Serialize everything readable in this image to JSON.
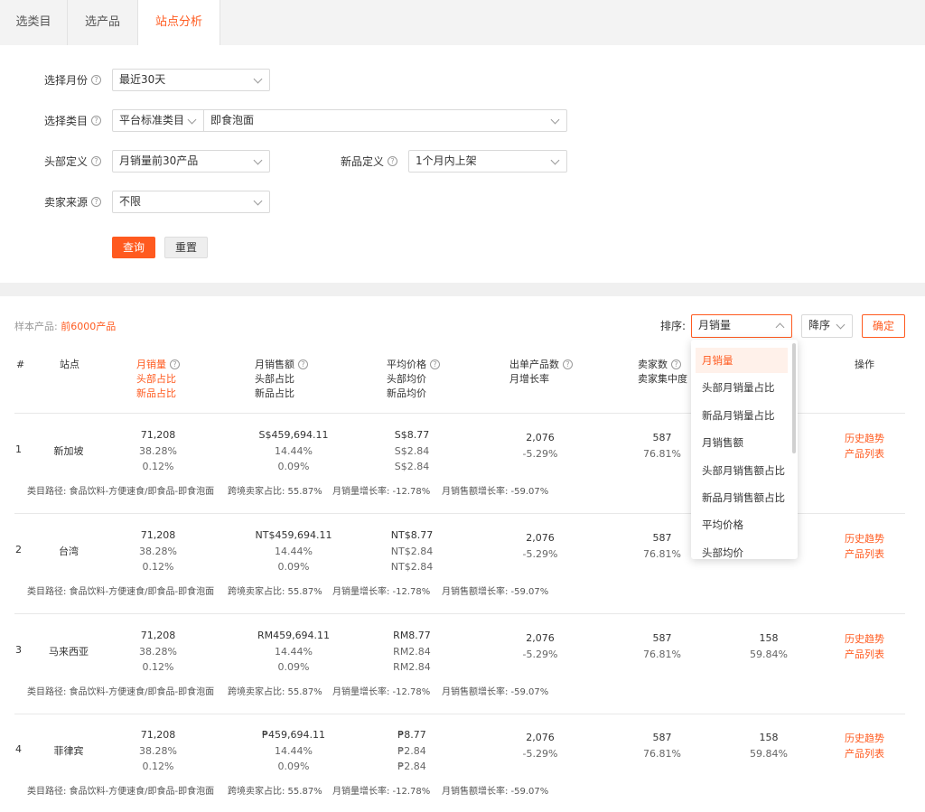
{
  "tabs": [
    "选类目",
    "选产品",
    "站点分析"
  ],
  "filters": {
    "month_label": "选择月份",
    "month_value": "最近30天",
    "category_label": "选择类目",
    "category_type": "平台标准类目",
    "category_value": "即食泡面",
    "head_label": "头部定义",
    "head_value": "月销量前30产品",
    "new_label": "新品定义",
    "new_value": "1个月内上架",
    "seller_label": "卖家来源",
    "seller_value": "不限",
    "query_button": "查询",
    "reset_button": "重置",
    "help_glyph": "?"
  },
  "results": {
    "sample_label": "样本产品:",
    "sample_value": "前6000产品",
    "sort_label": "排序:",
    "sort_value": "月销量",
    "order_value": "降序",
    "confirm_button": "确定"
  },
  "table": {
    "headers": {
      "idx": "#",
      "site": "站点",
      "sales": [
        "月销量",
        "头部占比",
        "新品占比"
      ],
      "revenue": [
        "月销售额",
        "头部占比",
        "新品占比"
      ],
      "price": [
        "平均价格",
        "头部均价",
        "新品均价"
      ],
      "products": [
        "出单产品数",
        "月增长率"
      ],
      "sellers": [
        "卖家数",
        "卖家集中度"
      ],
      "action": "操作"
    },
    "rows": [
      {
        "idx": "1",
        "site": "新加坡",
        "sales": [
          "71,208",
          "38.28%",
          "0.12%"
        ],
        "revenue": [
          "S$459,694.11",
          "14.44%",
          "0.09%"
        ],
        "price": [
          "S$8.77",
          "S$2.84",
          "S$2.84"
        ],
        "products": [
          "2,076",
          "-5.29%"
        ],
        "sellers": [
          "587",
          "76.81%"
        ],
        "extra": [
          "",
          ""
        ],
        "actions": [
          "历史趋势",
          "产品列表"
        ],
        "meta": {
          "path": "类目路径: 食品饮料-方便速食/即食品-即食泡面",
          "cross": "跨境卖家占比: 55.87%",
          "sales_growth": "月销量增长率: -12.78%",
          "revenue_growth": "月销售额增长率: -59.07%"
        }
      },
      {
        "idx": "2",
        "site": "台湾",
        "sales": [
          "71,208",
          "38.28%",
          "0.12%"
        ],
        "revenue": [
          "NT$459,694.11",
          "14.44%",
          "0.09%"
        ],
        "price": [
          "NT$8.77",
          "NT$2.84",
          "NT$2.84"
        ],
        "products": [
          "2,076",
          "-5.29%"
        ],
        "sellers": [
          "587",
          "76.81%"
        ],
        "extra": [
          "",
          ""
        ],
        "actions": [
          "历史趋势",
          "产品列表"
        ],
        "meta": {
          "path": "类目路径: 食品饮料-方便速食/即食品-即食泡面",
          "cross": "跨境卖家占比: 55.87%",
          "sales_growth": "月销量增长率: -12.78%",
          "revenue_growth": "月销售额增长率: -59.07%"
        }
      },
      {
        "idx": "3",
        "site": "马来西亚",
        "sales": [
          "71,208",
          "38.28%",
          "0.12%"
        ],
        "revenue": [
          "RM459,694.11",
          "14.44%",
          "0.09%"
        ],
        "price": [
          "RM8.77",
          "RM2.84",
          "RM2.84"
        ],
        "products": [
          "2,076",
          "-5.29%"
        ],
        "sellers": [
          "587",
          "76.81%"
        ],
        "extra": [
          "158",
          "59.84%"
        ],
        "actions": [
          "历史趋势",
          "产品列表"
        ],
        "meta": {
          "path": "类目路径: 食品饮料-方便速食/即食品-即食泡面",
          "cross": "跨境卖家占比: 55.87%",
          "sales_growth": "月销量增长率: -12.78%",
          "revenue_growth": "月销售额增长率: -59.07%"
        }
      },
      {
        "idx": "4",
        "site": "菲律宾",
        "sales": [
          "71,208",
          "38.28%",
          "0.12%"
        ],
        "revenue": [
          "₱459,694.11",
          "14.44%",
          "0.09%"
        ],
        "price": [
          "₱8.77",
          "₱2.84",
          "₱2.84"
        ],
        "products": [
          "2,076",
          "-5.29%"
        ],
        "sellers": [
          "587",
          "76.81%"
        ],
        "extra": [
          "158",
          "59.84%"
        ],
        "actions": [
          "历史趋势",
          "产品列表"
        ],
        "meta": {
          "path": "类目路径: 食品饮料-方便速食/即食品-即食泡面",
          "cross": "跨境卖家占比: 55.87%",
          "sales_growth": "月销量增长率: -12.78%",
          "revenue_growth": "月销售额增长率: -59.07%"
        }
      }
    ]
  },
  "dropdown": {
    "options": [
      "月销量",
      "头部月销量占比",
      "新品月销量占比",
      "月销售额",
      "头部月销售额占比",
      "新品月销售额占比",
      "平均价格",
      "头部均价"
    ],
    "selected": "月销量"
  },
  "colors": {
    "accent": "#ff5a1f"
  }
}
